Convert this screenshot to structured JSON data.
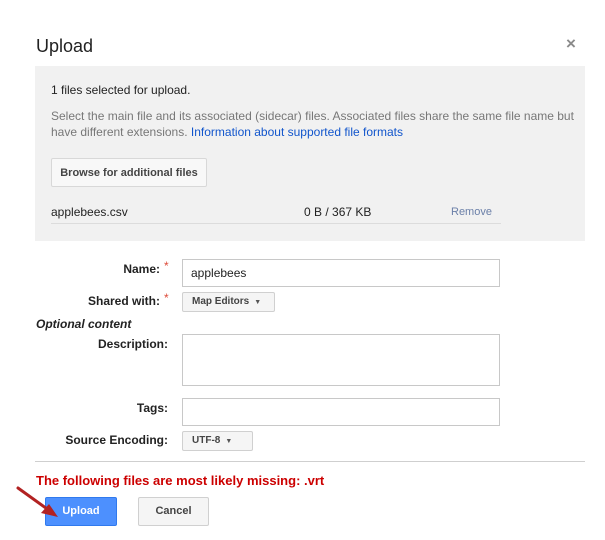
{
  "dialog": {
    "title": "Upload",
    "close_glyph": "×"
  },
  "upload_panel": {
    "selected_text": "1 files selected for upload.",
    "description": "Select the main file and its associated (sidecar) files. Associated files share the same file name but have different extensions.",
    "info_link": "Information about supported file formats",
    "browse_label": "Browse for additional files",
    "file": {
      "name": "applebees.csv",
      "progress": "0 B / 367 KB",
      "remove_label": "Remove"
    }
  },
  "form": {
    "name_label": "Name:",
    "name_value": "applebees",
    "shared_label": "Shared with:",
    "shared_value": "Map Editors",
    "optional_heading": "Optional content",
    "description_label": "Description:",
    "description_value": "",
    "tags_label": "Tags:",
    "tags_value": "",
    "encoding_label": "Source Encoding:",
    "encoding_value": "UTF-8",
    "required_marker": "*"
  },
  "warning": "The following files are most likely missing: .vrt",
  "actions": {
    "upload_label": "Upload",
    "cancel_label": "Cancel"
  },
  "colors": {
    "primary_button": "#4d90fe",
    "link": "#1155cc",
    "warning": "#cc0000",
    "annotation_arrow": "#b22222"
  }
}
